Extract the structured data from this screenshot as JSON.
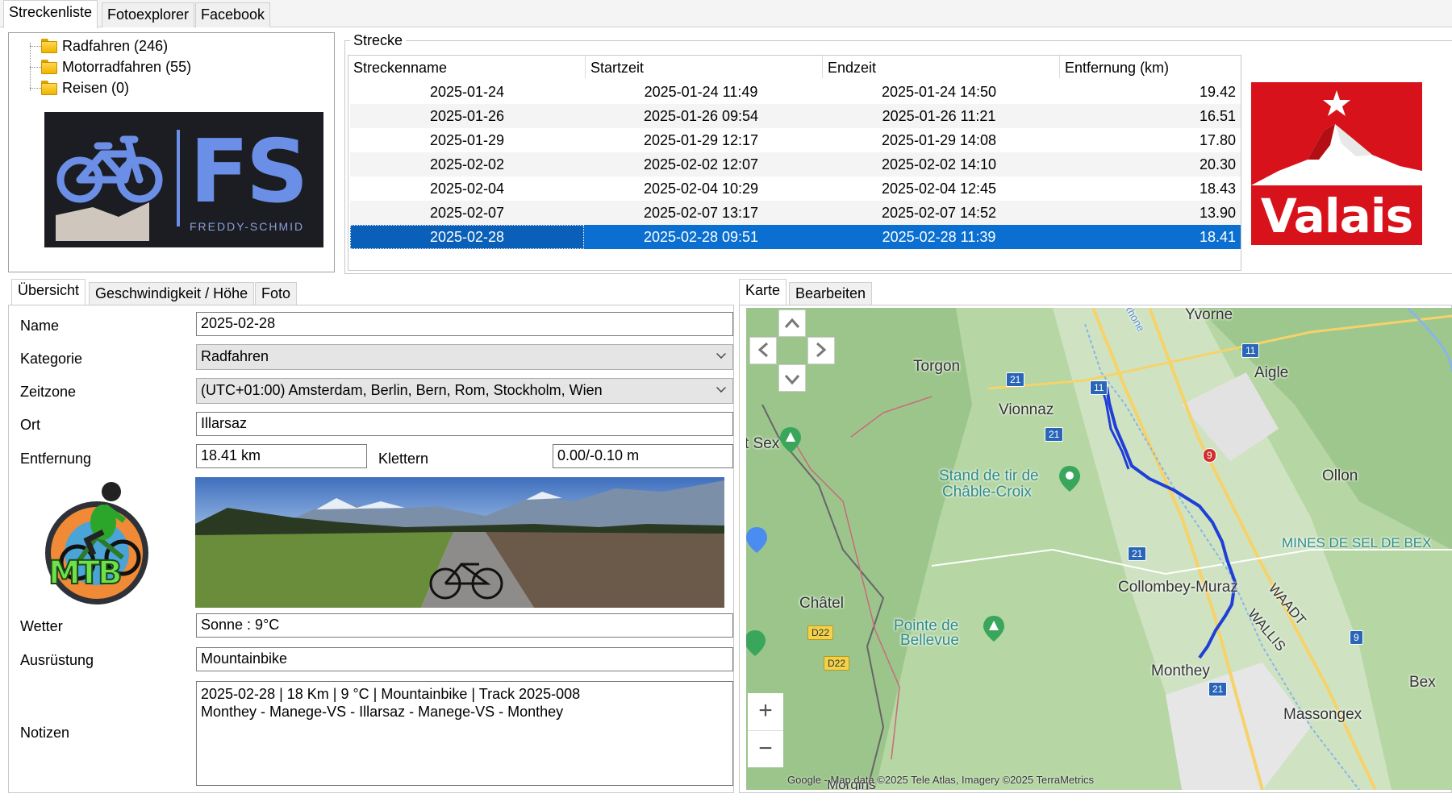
{
  "top_tabs": [
    "Streckenliste",
    "Fotoexplorer",
    "Facebook"
  ],
  "tree": [
    {
      "label": "Radfahren (246)"
    },
    {
      "label": "Motorradfahren (55)"
    },
    {
      "label": "Reisen (0)"
    }
  ],
  "fs_logo": {
    "letters": "FS",
    "subtitle": "FREDDY-SCHMID"
  },
  "strecke": {
    "group_label": "Strecke",
    "columns": [
      "Streckenname",
      "Startzeit",
      "Endzeit",
      "Entfernung (km)"
    ],
    "rows": [
      {
        "name": "2025-01-24",
        "start": "2025-01-24 11:49",
        "end": "2025-01-24 14:50",
        "dist": "19.42"
      },
      {
        "name": "2025-01-26",
        "start": "2025-01-26 09:54",
        "end": "2025-01-26 11:21",
        "dist": "16.51"
      },
      {
        "name": "2025-01-29",
        "start": "2025-01-29 12:17",
        "end": "2025-01-29 14:08",
        "dist": "17.80"
      },
      {
        "name": "2025-02-02",
        "start": "2025-02-02 12:07",
        "end": "2025-02-02 14:10",
        "dist": "20.30"
      },
      {
        "name": "2025-02-04",
        "start": "2025-02-04 10:29",
        "end": "2025-02-04 12:45",
        "dist": "18.43"
      },
      {
        "name": "2025-02-07",
        "start": "2025-02-07 13:17",
        "end": "2025-02-07 14:52",
        "dist": "13.90"
      },
      {
        "name": "2025-02-28",
        "start": "2025-02-28 09:51",
        "end": "2025-02-28 11:39",
        "dist": "18.41"
      }
    ],
    "selected_row": "2025-02-28"
  },
  "valais_logo": {
    "text": "Valais"
  },
  "lower_tabs": [
    "Übersicht",
    "Geschwindigkeit / Höhe",
    "Foto"
  ],
  "form": {
    "name_label": "Name",
    "name_value": "2025-02-28",
    "kategorie_label": "Kategorie",
    "kategorie_value": "Radfahren",
    "zeitzone_label": "Zeitzone",
    "zeitzone_value": "(UTC+01:00) Amsterdam, Berlin, Bern, Rom, Stockholm, Wien",
    "ort_label": "Ort",
    "ort_value": "Illarsaz",
    "entfernung_label": "Entfernung",
    "entfernung_value": "18.41 km",
    "klettern_label": "Klettern",
    "klettern_value": "0.00/-0.10 m",
    "wetter_label": "Wetter",
    "wetter_value": "Sonne  :  9°C",
    "ausruestung_label": "Ausrüstung",
    "ausruestung_value": "Mountainbike",
    "notizen_label": "Notizen",
    "notizen_line1": "2025-02-28  |  18 Km  |  9 °C  |  Mountainbike  |  Track 2025-008",
    "notizen_line2": "Monthey - Manege-VS - Illarsaz - Manege-VS - Monthey"
  },
  "mtb_logo": {
    "text": "MTB"
  },
  "map_tabs": [
    "Karte",
    "Bearbeiten"
  ],
  "map": {
    "labels": {
      "yvorne": "Yvorne",
      "aigle": "Aigle",
      "torgon": "Torgon",
      "vionnaz": "Vionnaz",
      "sex": "t Sex",
      "stand1": "Stand de tir de",
      "stand2": "Châble-Croix",
      "ollon": "Ollon",
      "mines": "MINES DE SEL DE BEX",
      "collombey": "Collombey-Muraz",
      "chatel": "Châtel",
      "pointe1": "Pointe de",
      "pointe2": "Bellevue",
      "monthey": "Monthey",
      "bex": "Bex",
      "massongex": "Massongex",
      "waadt": "WAADT",
      "wallis": "WALLIS",
      "rhone": "Rhone",
      "morgins": "Morgins"
    },
    "shields": {
      "s11a": "11",
      "s11b": "11",
      "s21a": "21",
      "s21b": "21",
      "s21c": "21",
      "s21d": "21",
      "s9a": "9",
      "s9b": "9",
      "d22a": "D22",
      "d22b": "D22"
    },
    "attribution": "Google - Map data ©2025 Tele Atlas, Imagery ©2025 TerraMetrics",
    "zoom_in": "+",
    "zoom_out": "−"
  }
}
